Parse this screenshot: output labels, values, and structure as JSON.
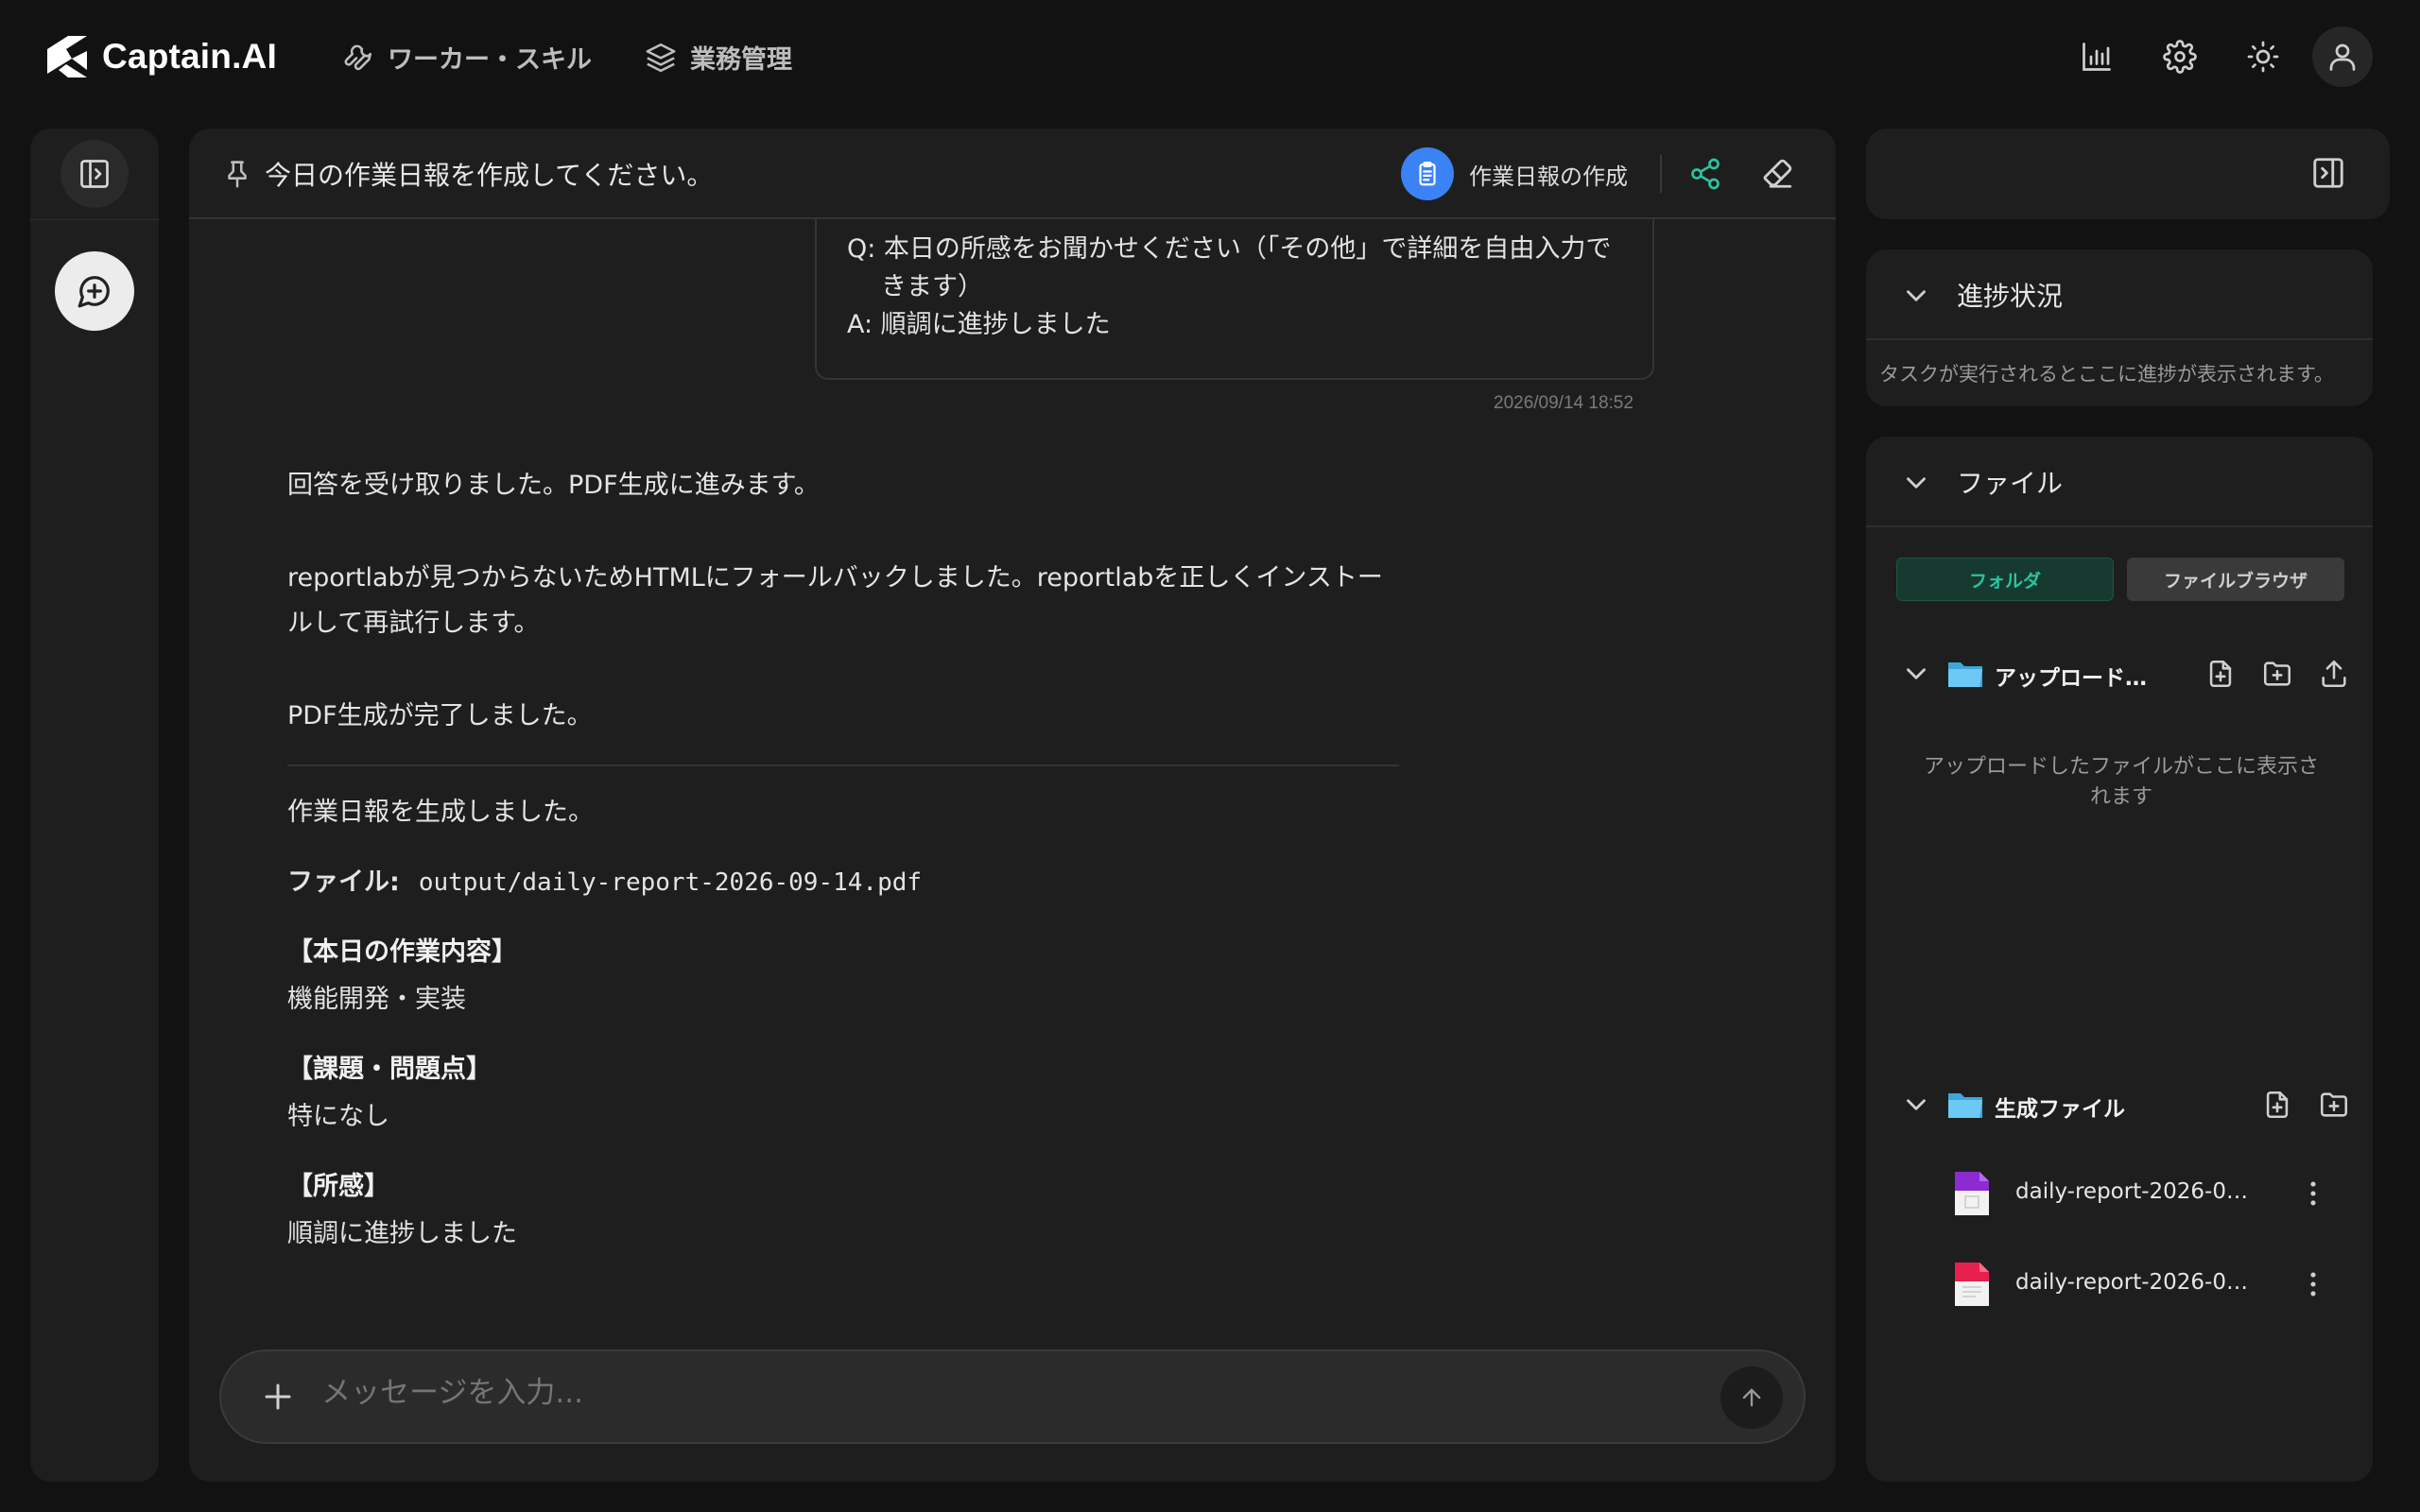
{
  "app": {
    "brand": "Captain.AI"
  },
  "header": {
    "nav": [
      {
        "label": "ワーカー・スキル",
        "icon": "wrench-icon"
      },
      {
        "label": "業務管理",
        "icon": "layers-icon"
      }
    ],
    "icons": [
      "bar-chart-icon",
      "gear-icon",
      "sun-icon",
      "user-icon"
    ]
  },
  "chat": {
    "title": "今日の作業日報を作成してください。",
    "task_label": "作業日報の作成",
    "user_message": {
      "question": "Q: 本日の所感をお聞かせください（「その他」で詳細を自由入力できます）",
      "answer": "A: 順調に進捗しました",
      "timestamp": "2026/09/14 18:52"
    },
    "assistant": {
      "line1": "回答を受け取りました。PDF生成に進みます。",
      "line2": "reportlabが見つからないためHTMLにフォールバックしました。reportlabを正しくインストールして再試行します。",
      "line3": "PDF生成が完了しました。",
      "summary": "作業日報を生成しました。",
      "file_label": "ファイル:",
      "file_path": "output/daily-report-2026-09-14.pdf",
      "sections": [
        {
          "title": "【本日の作業内容】",
          "body": "機能開発・実装"
        },
        {
          "title": "【課題・問題点】",
          "body": "特になし"
        },
        {
          "title": "【所感】",
          "body": "順調に進捗しました"
        }
      ]
    },
    "composer": {
      "placeholder": "メッセージを入力..."
    }
  },
  "right_panel": {
    "progress": {
      "title": "進捗状況",
      "empty_text": "タスクが実行されるとここに進捗が表示されます。"
    },
    "files": {
      "title": "ファイル",
      "tabs": [
        "フォルダ",
        "ファイルブラウザ"
      ],
      "active_tab": "フォルダ",
      "upload_folder": {
        "name": "アップロード…",
        "empty_text": "アップロードしたファイルがここに表示されます"
      },
      "generated_folder": {
        "name": "生成ファイル",
        "files": [
          {
            "name": "daily-report-2026-0…",
            "color": "#8b2bd1"
          },
          {
            "name": "daily-report-2026-0…",
            "color": "#e8204f"
          }
        ]
      }
    }
  },
  "colors": {
    "accent": "#2cc3a0",
    "task_blue": "#3b82f6",
    "background": "#121212",
    "panel": "#1e1e1e"
  }
}
